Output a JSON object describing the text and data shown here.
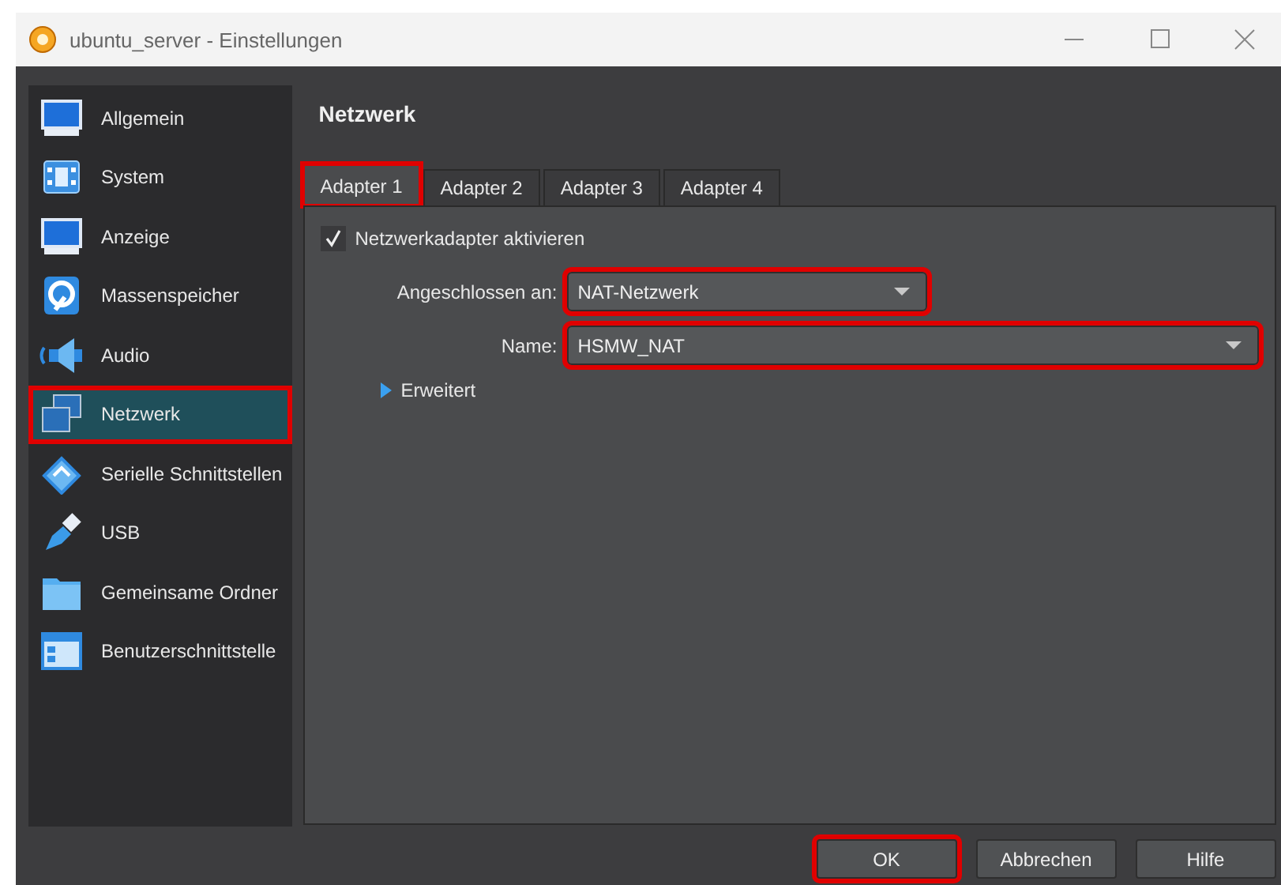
{
  "window": {
    "title": "ubuntu_server - Einstellungen"
  },
  "sidebar": {
    "items": [
      {
        "label": "Allgemein",
        "kind": "monitor",
        "selected": false,
        "highlighted": false
      },
      {
        "label": "System",
        "kind": "chip",
        "selected": false,
        "highlighted": false
      },
      {
        "label": "Anzeige",
        "kind": "monitor",
        "selected": false,
        "highlighted": false
      },
      {
        "label": "Massenspeicher",
        "kind": "disk",
        "selected": false,
        "highlighted": false
      },
      {
        "label": "Audio",
        "kind": "speaker",
        "selected": false,
        "highlighted": false
      },
      {
        "label": "Netzwerk",
        "kind": "network",
        "selected": true,
        "highlighted": true
      },
      {
        "label": "Serielle Schnittstellen",
        "kind": "serial",
        "selected": false,
        "highlighted": false
      },
      {
        "label": "USB",
        "kind": "usb",
        "selected": false,
        "highlighted": false
      },
      {
        "label": "Gemeinsame Ordner",
        "kind": "folder",
        "selected": false,
        "highlighted": false
      },
      {
        "label": "Benutzerschnittstelle",
        "kind": "ui",
        "selected": false,
        "highlighted": false
      }
    ]
  },
  "page": {
    "title": "Netzwerk"
  },
  "tabs": [
    {
      "label": "Adapter 1",
      "selected": true,
      "highlighted": true
    },
    {
      "label": "Adapter 2",
      "selected": false,
      "highlighted": false
    },
    {
      "label": "Adapter 3",
      "selected": false,
      "highlighted": false
    },
    {
      "label": "Adapter 4",
      "selected": false,
      "highlighted": false
    }
  ],
  "enable": {
    "label": "Netzwerkadapter aktivieren",
    "checked": true
  },
  "fields": [
    {
      "label": "Angeschlossen an:",
      "value": "NAT-Netzwerk",
      "highlighted": true
    },
    {
      "label": "Name:",
      "value": "HSMW_NAT",
      "highlighted": true
    }
  ],
  "advanced": {
    "label": "Erweitert",
    "expanded": false
  },
  "buttons": [
    {
      "label": "OK",
      "highlighted": true
    },
    {
      "label": "Abbrechen",
      "highlighted": false
    },
    {
      "label": "Hilfe",
      "highlighted": false
    }
  ]
}
